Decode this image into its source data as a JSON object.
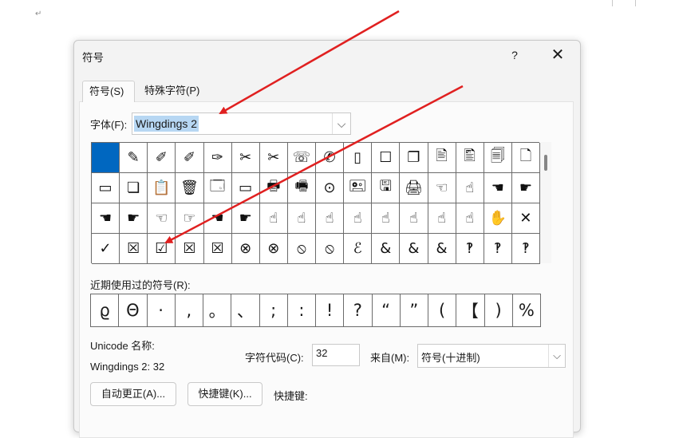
{
  "dialog": {
    "title": "符号",
    "help_label": "?",
    "close_label": "✕"
  },
  "tabs": [
    {
      "label": "符号(S)",
      "active": true
    },
    {
      "label": "特殊字符(P)",
      "active": false
    }
  ],
  "font": {
    "label": "字体(F):",
    "value": "Wingdings 2",
    "dropdown_glyph": "⌵"
  },
  "symbol_grid": {
    "selected_index": 0,
    "rows": [
      [
        " ",
        "✎",
        "✐",
        "✐",
        "✑",
        "✂",
        "✂",
        "☏",
        "✆",
        "▯",
        "☐",
        "❐",
        "🖹",
        "🖺",
        "🗐",
        "🗋"
      ],
      [
        "▭",
        "❏",
        "📋",
        "🗑",
        "🗔",
        "▭",
        "🖶",
        "🖷",
        "⊙",
        "🖭",
        "🖫",
        "🖨",
        "☜",
        "☝",
        "☚",
        "☛"
      ],
      [
        "☚",
        "☛",
        "☜",
        "☞",
        "☚",
        "☛",
        "☝",
        "☝",
        "☝",
        "☝",
        "☝",
        "☝",
        "☝",
        "☝",
        "✋",
        "✕"
      ],
      [
        "✓",
        "☒",
        "☑",
        "☒",
        "☒",
        "⊗",
        "⊗",
        "⦸",
        "⦸",
        "ℰ",
        "&",
        "&",
        "&",
        "‽",
        "‽",
        "‽"
      ]
    ]
  },
  "recent": {
    "label": "近期使用过的符号(R):",
    "symbols": [
      "ϱ",
      "Θ",
      "·",
      ",",
      "。",
      "、",
      ";",
      ":",
      "!",
      "?",
      "“",
      "”",
      "(",
      "【",
      ")",
      "%"
    ]
  },
  "info": {
    "unicode_name_label": "Unicode 名称:",
    "unicode_name_value": "Wingdings 2: 32",
    "char_code_label": "字符代码(C):",
    "char_code_value": "32",
    "from_label": "来自(M):",
    "from_value": "符号(十进制)",
    "from_dropdown_glyph": "⌵"
  },
  "buttons": {
    "autocorrect": "自动更正(A)...",
    "shortcut_key": "快捷键(K)...",
    "shortcut_label": "快捷键:"
  },
  "document": {
    "paragraph_mark": "↵"
  },
  "colors": {
    "accent": "#0067c0",
    "highlight": "#b7d7f3",
    "annotation": "#e02020"
  }
}
